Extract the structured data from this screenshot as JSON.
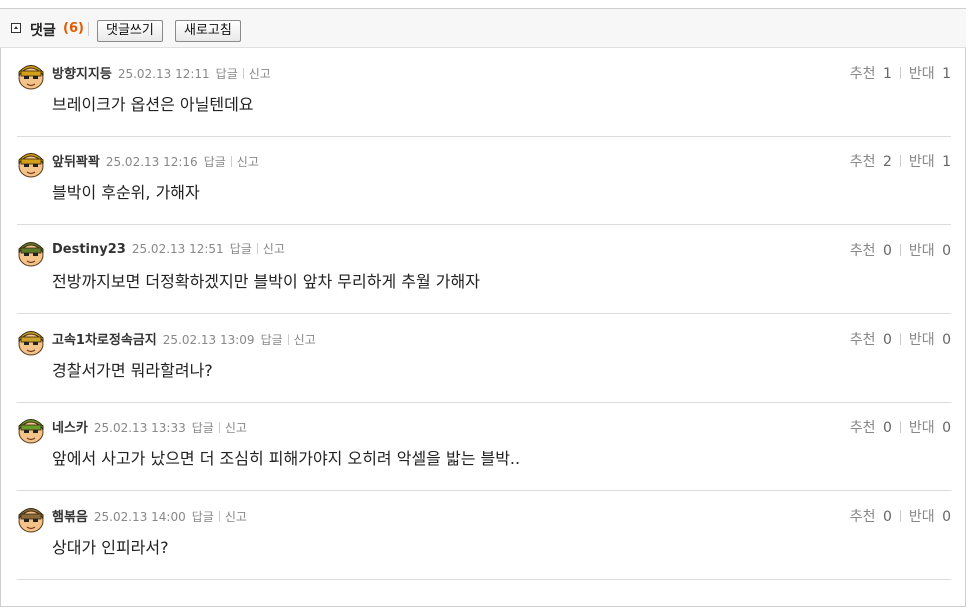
{
  "header": {
    "title": "댓글",
    "count": "(6)",
    "write_label": "댓글쓰기",
    "refresh_label": "새로고침"
  },
  "colors": {
    "count": "#e05a00",
    "divider": "#dcdcdc"
  },
  "comments": [
    {
      "author": "방향지지등",
      "date": "25.02.13 12:11",
      "reply": "답글",
      "report": "신고",
      "text": "브레이크가 옵션은 아닐텐데요",
      "up_label": "추천",
      "up": "1",
      "down_label": "반대",
      "down": "1",
      "avatar": "avatar-yellow-helmet"
    },
    {
      "author": "앞뒤꽉꽉",
      "date": "25.02.13 12:16",
      "reply": "답글",
      "report": "신고",
      "text": "블박이 후순위, 가해자",
      "up_label": "추천",
      "up": "2",
      "down_label": "반대",
      "down": "1",
      "avatar": "avatar-yellow-helmet"
    },
    {
      "author": "Destiny23",
      "date": "25.02.13 12:51",
      "reply": "답글",
      "report": "신고",
      "text": "전방까지보면 더정확하겠지만 블박이 앞차 무리하게 추월 가해자",
      "up_label": "추천",
      "up": "0",
      "down_label": "반대",
      "down": "0",
      "avatar": "avatar-green-hair"
    },
    {
      "author": "고속1차로정속금지",
      "date": "25.02.13 13:09",
      "reply": "답글",
      "report": "신고",
      "text": "경찰서가면 뭐라할려나?",
      "up_label": "추천",
      "up": "0",
      "down_label": "반대",
      "down": "0",
      "avatar": "avatar-crown"
    },
    {
      "author": "네스카",
      "date": "25.02.13 13:33",
      "reply": "답글",
      "report": "신고",
      "text": "앞에서 사고가 났으면 더 조심히 피해가야지 오히려 악셀을 밟는 블박..",
      "up_label": "추천",
      "up": "0",
      "down_label": "반대",
      "down": "0",
      "avatar": "avatar-green-band"
    },
    {
      "author": "햄볶음",
      "date": "25.02.13 14:00",
      "reply": "답글",
      "report": "신고",
      "text": "상대가 인피라서?",
      "up_label": "추천",
      "up": "0",
      "down_label": "반대",
      "down": "0",
      "avatar": "avatar-helmet-brown"
    }
  ]
}
